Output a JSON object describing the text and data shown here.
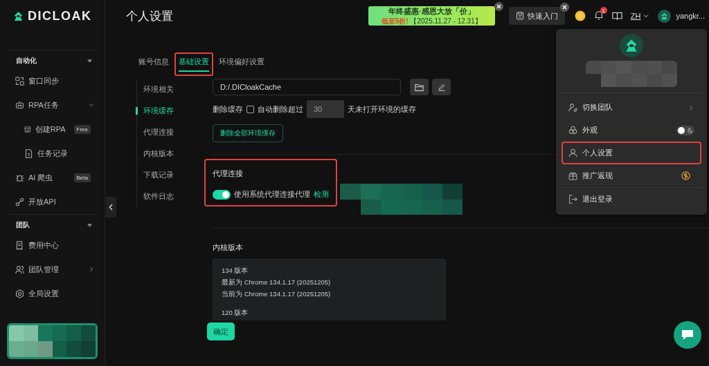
{
  "logo": {
    "text": "DICLOAK"
  },
  "sidebar": {
    "sections": [
      {
        "title": "自动化",
        "items": [
          {
            "label": "窗口同步"
          },
          {
            "label": "RPA任务",
            "expanded": true,
            "children": [
              {
                "label": "创建RPA",
                "badge": "Free"
              },
              {
                "label": "任务记录"
              }
            ]
          },
          {
            "label": "AI 爬虫",
            "badge": "Beta"
          },
          {
            "label": "开放API"
          }
        ]
      },
      {
        "title": "团队",
        "items": [
          {
            "label": "费用中心"
          },
          {
            "label": "团队管理",
            "expanded": false
          },
          {
            "label": "全局设置"
          }
        ]
      }
    ]
  },
  "header": {
    "title": "个人设置",
    "promo": {
      "title": "年终盛惠·感恩大放「价」",
      "highlight": "低至5折!",
      "dates": "【2025.11.27 - 12.31】"
    },
    "quick_start": "快速入门",
    "notification_count": "1",
    "language": "ZH",
    "user": "yangkr..."
  },
  "tabs": [
    {
      "label": "账号信息",
      "selected": false,
      "highlighted": false
    },
    {
      "label": "基础设置",
      "selected": true,
      "highlighted": true
    },
    {
      "label": "环境偏好设置",
      "selected": false,
      "highlighted": false
    }
  ],
  "nav": [
    {
      "label": "环境相关",
      "selected": false
    },
    {
      "label": "环境缓存",
      "selected": true
    },
    {
      "label": "代理连接",
      "selected": false
    },
    {
      "label": "内核版本",
      "selected": false
    },
    {
      "label": "下载记录",
      "selected": false
    },
    {
      "label": "软件日志",
      "selected": false
    }
  ],
  "cache": {
    "path": "D:/.DICloakCache",
    "delete_label": "删除缓存",
    "auto_delete": {
      "checked": false,
      "label": "自动删除超过",
      "days": "30",
      "suffix": "天未打开环境的缓存"
    },
    "delete_all_button": "删除全部环境缓存"
  },
  "proxy": {
    "title": "代理连接",
    "highlighted": true,
    "toggle": {
      "on": true,
      "label": "使用系统代理连接代理"
    },
    "link": "检测"
  },
  "kernel": {
    "title": "内核版本",
    "groups": [
      {
        "version": "134 版本",
        "lines": [
          "最新为 Chrome 134.1.17 (20251205)",
          "当前为 Chrome 134.1.17 (20251205)"
        ]
      },
      {
        "version": "120 版本"
      }
    ]
  },
  "confirm_button": "确定",
  "user_menu": {
    "items": [
      {
        "label": "切换团队",
        "kind": "submenu",
        "highlighted": false
      },
      {
        "label": "外观",
        "kind": "toggle",
        "on": false,
        "highlighted": false
      },
      {
        "label": "个人设置",
        "kind": "plain",
        "highlighted": true
      },
      {
        "label": "推广返现",
        "kind": "reward",
        "highlighted": false
      },
      {
        "label": "退出登录",
        "kind": "logout",
        "highlighted": false
      }
    ]
  }
}
